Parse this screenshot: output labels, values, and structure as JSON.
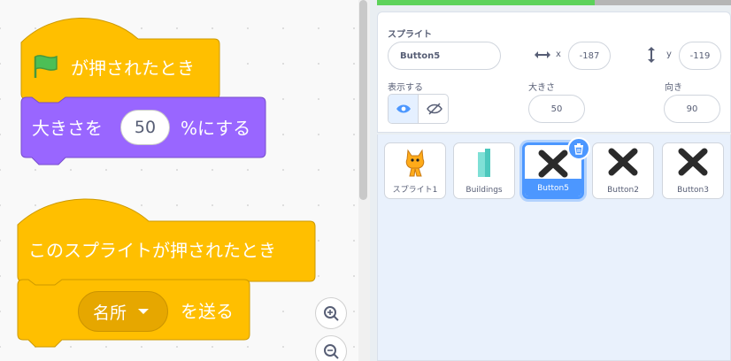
{
  "code_area": {
    "script1": {
      "hat_label": "が押されたとき",
      "block_label_before": "大きさを",
      "size_value": "50",
      "block_label_after": "%にする"
    },
    "script2": {
      "hat_label": "このスプライトが押されたとき",
      "broadcast_option": "名所",
      "broadcast_label": "を送る"
    },
    "colors": {
      "events": "#ffbf00",
      "looks": "#9966ff"
    }
  },
  "sprite_info": {
    "sprite_label": "スプライト",
    "sprite_name": "Button5",
    "x_label": "x",
    "x_value": "-187",
    "y_label": "y",
    "y_value": "-119",
    "show_label": "表示する",
    "size_label": "大きさ",
    "size_value": "50",
    "direction_label": "向き",
    "direction_value": "90"
  },
  "sprites": [
    {
      "name": "スプライト1",
      "icon": "cat-icon"
    },
    {
      "name": "Buildings",
      "icon": "building-icon"
    },
    {
      "name": "Button5",
      "icon": "x-icon",
      "selected": true
    },
    {
      "name": "Button2",
      "icon": "x-icon"
    },
    {
      "name": "Button3",
      "icon": "x-icon"
    }
  ]
}
